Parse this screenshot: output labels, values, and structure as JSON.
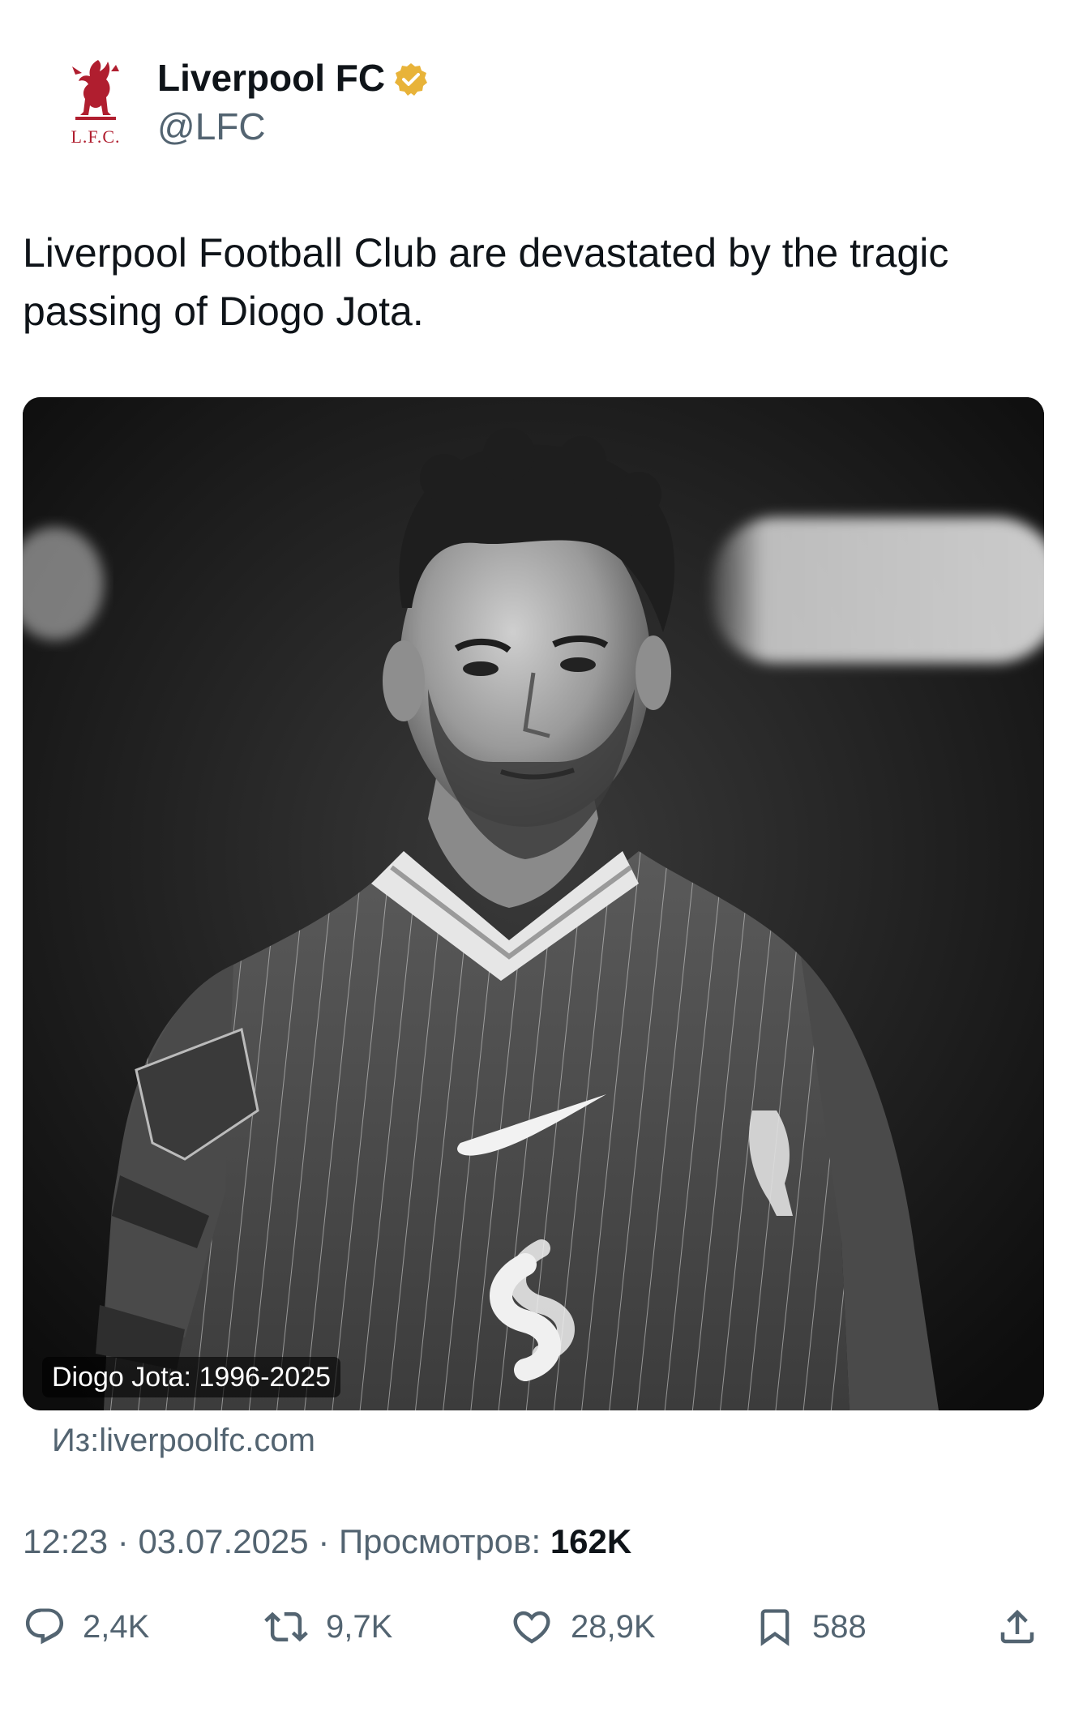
{
  "author": {
    "display_name": "Liverpool FC",
    "handle": "@LFC",
    "avatar_text": "L.F.C.",
    "verified": true,
    "verified_color": "#e8b339"
  },
  "tweet": {
    "text": "Liverpool Football Club are devastated by the tragic passing of Diogo Jota."
  },
  "media": {
    "caption": "Diogo Jota: 1996-2025",
    "source": "Из:liverpoolfc.com"
  },
  "meta": {
    "time": "12:23",
    "date": "03.07.2025",
    "views_label": "Просмотров:",
    "views_count": "162K"
  },
  "actions": {
    "reply_count": "2,4K",
    "retweet_count": "9,7K",
    "like_count": "28,9K",
    "bookmark_count": "588",
    "icons": [
      "reply-icon",
      "retweet-icon",
      "like-icon",
      "bookmark-icon",
      "share-icon"
    ]
  },
  "colors": {
    "text_primary": "#0f1419",
    "text_secondary": "#536471",
    "brand_red": "#b01e2f"
  }
}
